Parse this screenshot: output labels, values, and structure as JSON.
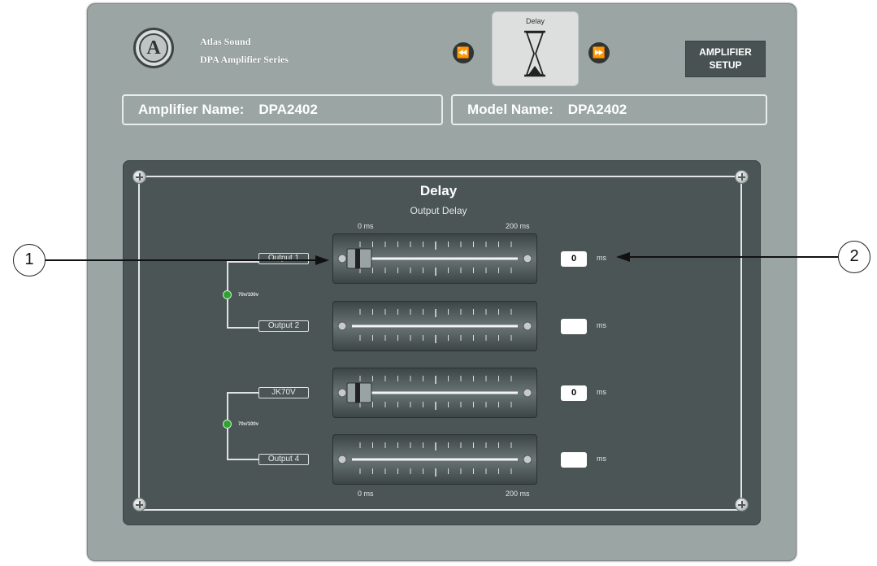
{
  "brand": {
    "line1": "Atlas Sound",
    "line2": "DPA Amplifier Series",
    "logo_letter": "A"
  },
  "nav": {
    "prev_icon": "⏪",
    "next_icon": "⏩",
    "current_tile_label": "Delay"
  },
  "amplifier_setup": {
    "line1": "AMPLIFIER",
    "line2": "SETUP"
  },
  "amplifier_name": {
    "label": "Amplifier Name:",
    "value": "DPA2402"
  },
  "model_name": {
    "label": "Model Name:",
    "value": "DPA2402"
  },
  "panel": {
    "title": "Delay",
    "subtitle": "Output Delay",
    "scale_top": {
      "min": "0 ms",
      "max": "200 ms"
    },
    "scale_bottom": {
      "min": "0 ms",
      "max": "200 ms"
    },
    "link_label": "70v/100v",
    "unit": "ms",
    "channels": [
      {
        "label": "Output 1",
        "value": "0",
        "active": true
      },
      {
        "label": "Output 2",
        "value": "",
        "active": false
      },
      {
        "label": "JK70V",
        "value": "0",
        "active": true
      },
      {
        "label": "Output 4",
        "value": "",
        "active": false
      }
    ]
  },
  "callouts": {
    "one": "1",
    "two": "2"
  }
}
